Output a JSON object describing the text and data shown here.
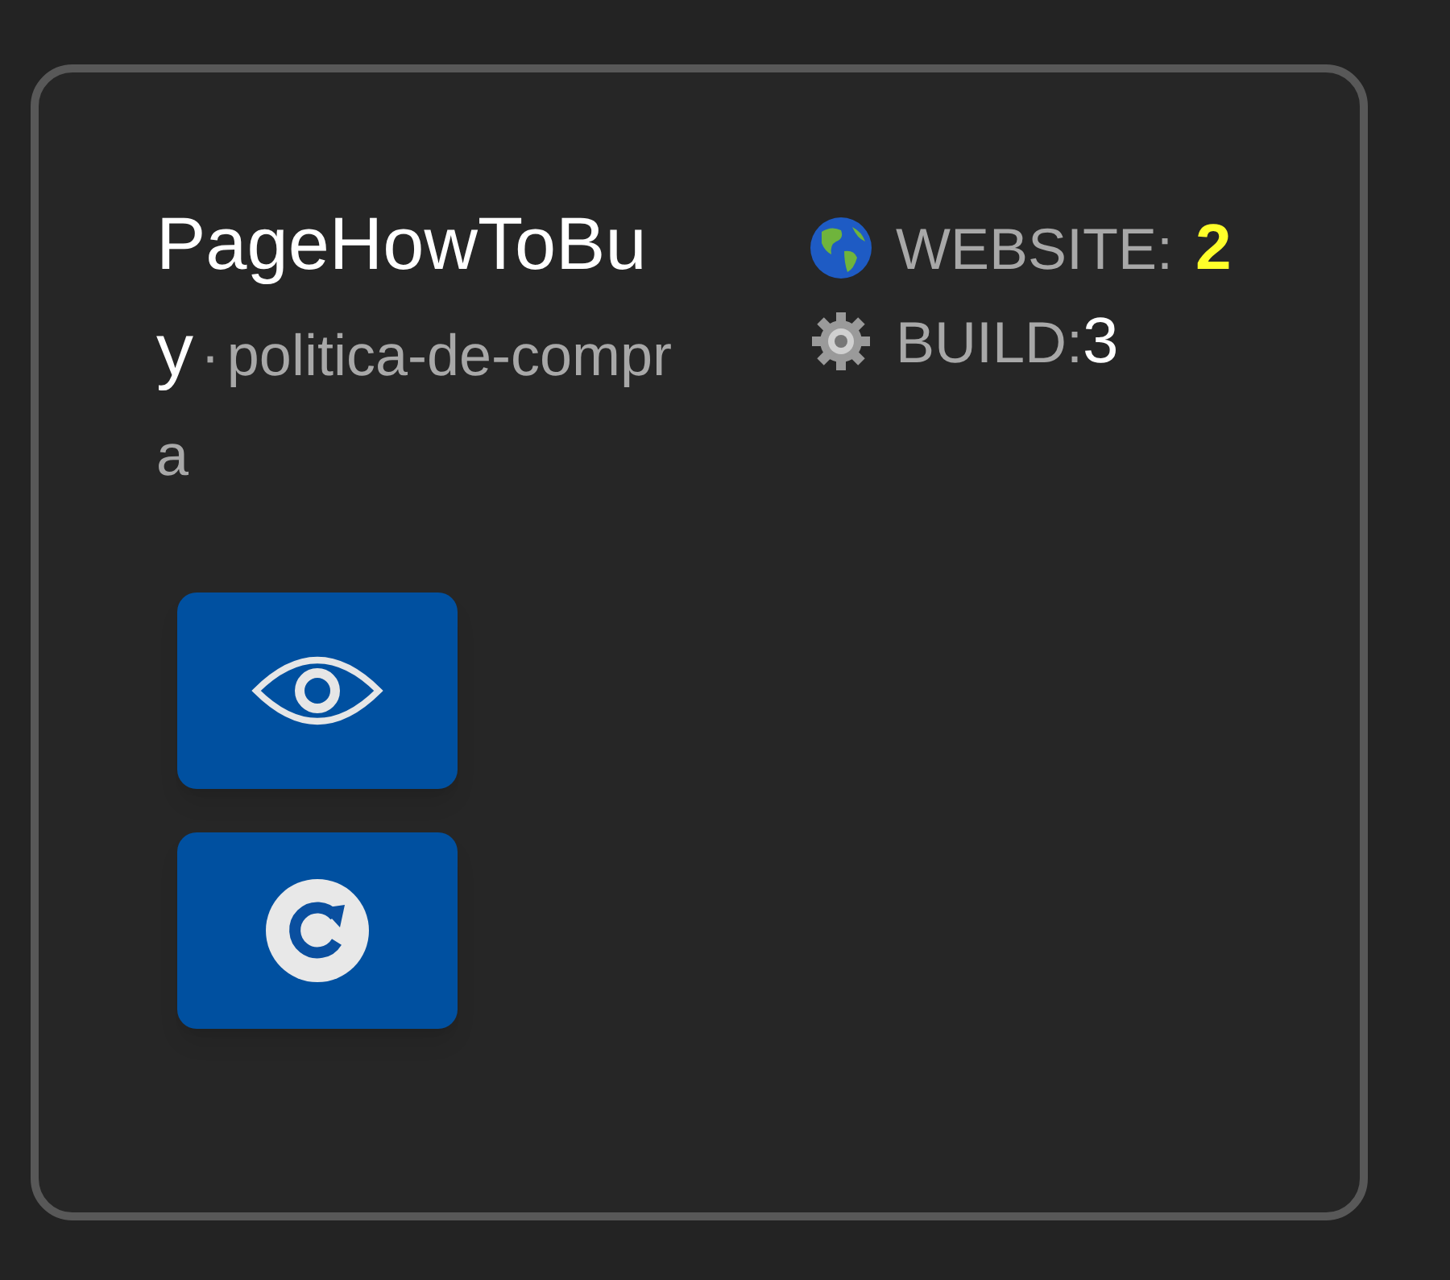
{
  "card": {
    "title": "PageHowToBuy",
    "separator": "·",
    "slug": "politica-de-compra",
    "stats": [
      {
        "kind": "website",
        "label": "WEBSITE:",
        "value": "2"
      },
      {
        "kind": "build",
        "label": "BUILD:",
        "value": "3"
      }
    ],
    "actions": [
      {
        "kind": "view"
      },
      {
        "kind": "refresh"
      }
    ]
  }
}
